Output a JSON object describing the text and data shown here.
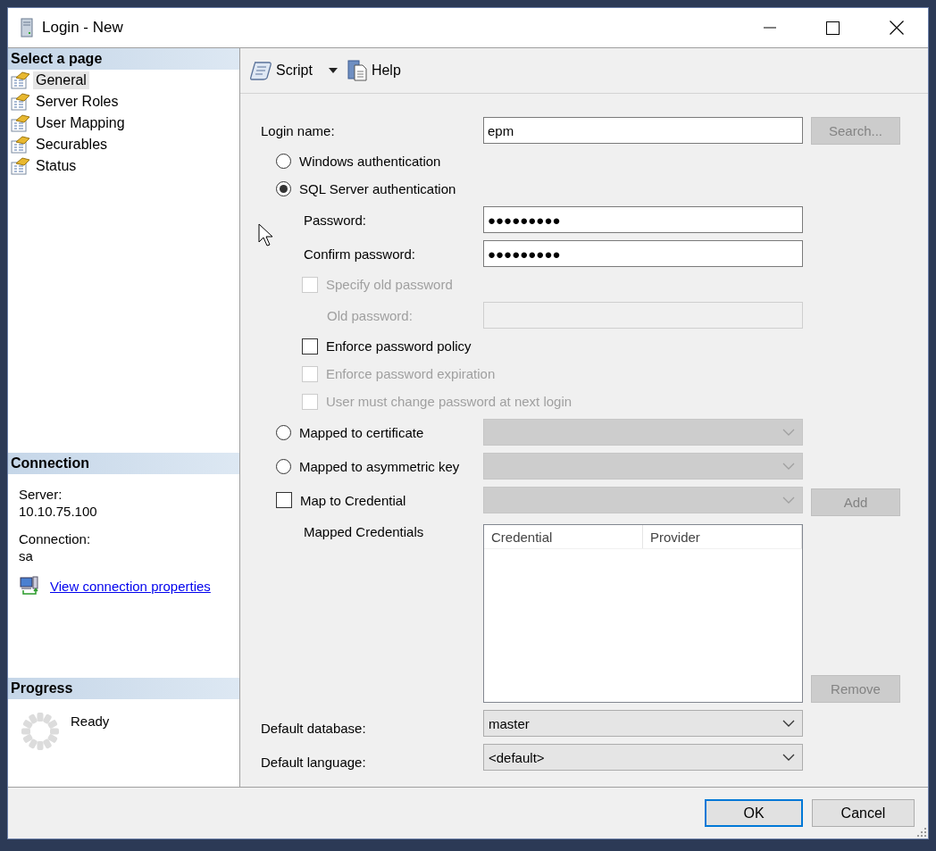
{
  "window": {
    "title": "Login - New"
  },
  "sidebar": {
    "header": "Select a page",
    "pages": [
      {
        "label": "General",
        "selected": true
      },
      {
        "label": "Server Roles",
        "selected": false
      },
      {
        "label": "User Mapping",
        "selected": false
      },
      {
        "label": "Securables",
        "selected": false
      },
      {
        "label": "Status",
        "selected": false
      }
    ]
  },
  "connection": {
    "header": "Connection",
    "items": [
      {
        "label": "Server:",
        "value": "10.10.75.100"
      },
      {
        "label": "Connection:",
        "value": "sa"
      }
    ],
    "link": "View connection properties"
  },
  "progress": {
    "header": "Progress",
    "status": "Ready"
  },
  "toolbar": {
    "items": [
      {
        "kind": "script",
        "label": "Script"
      },
      {
        "kind": "help",
        "label": "Help"
      }
    ]
  },
  "form": {
    "rows": [
      {
        "kind": "text",
        "label": "Login name:",
        "value": "epm",
        "disabled": false,
        "button": {
          "label": "Search...",
          "disabled": true
        }
      },
      {
        "kind": "radio",
        "label": "Windows authentication",
        "selected": false
      },
      {
        "kind": "radio",
        "label": "SQL Server authentication",
        "selected": true,
        "children": [
          {
            "kind": "text",
            "label": "Password:",
            "value": "●●●●●●●●●",
            "disabled": false
          },
          {
            "kind": "text",
            "label": "Confirm password:",
            "value": "●●●●●●●●●",
            "disabled": false
          },
          {
            "kind": "checkbox",
            "label": "Specify old password",
            "checked": false,
            "disabled": true,
            "children": [
              {
                "kind": "text",
                "label": "Old password:",
                "disabled": true
              }
            ]
          },
          {
            "kind": "checkbox",
            "label": "Enforce password policy",
            "checked": false,
            "disabled": false
          },
          {
            "kind": "checkbox",
            "label": "Enforce password expiration",
            "checked": false,
            "disabled": true
          },
          {
            "kind": "checkbox",
            "label": "User must change password at next login",
            "checked": false,
            "disabled": true
          }
        ]
      },
      {
        "kind": "radio",
        "label": "Mapped to certificate",
        "selected": false,
        "combo": {
          "disabled": true
        }
      },
      {
        "kind": "radio",
        "label": "Mapped to asymmetric key",
        "selected": false,
        "combo": {
          "disabled": true
        }
      },
      {
        "kind": "checkbox",
        "label": "Map to Credential",
        "checked": false,
        "disabled": false,
        "combo": {
          "disabled": true
        },
        "button": {
          "label": "Add",
          "disabled": true
        },
        "children": [
          {
            "kind": "table",
            "label": "Mapped Credentials",
            "columns": [
              "Credential",
              "Provider"
            ],
            "button": {
              "label": "Remove",
              "disabled": true
            }
          }
        ]
      },
      {
        "kind": "combo",
        "label": "Default database:",
        "value": "master",
        "disabled": false
      },
      {
        "kind": "combo",
        "label": "Default language:",
        "value": "<default>",
        "disabled": false
      }
    ]
  },
  "footer": {
    "buttons": [
      {
        "label": "OK",
        "default": true
      },
      {
        "label": "Cancel",
        "default": false
      }
    ]
  }
}
